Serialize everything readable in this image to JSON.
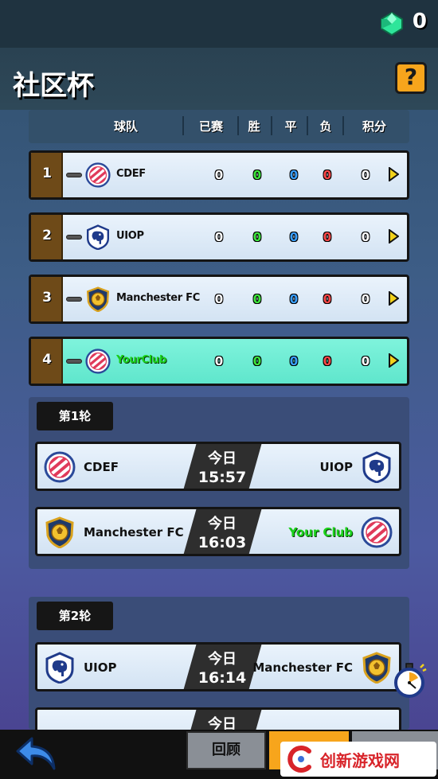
{
  "currency": {
    "icon": "gem-icon",
    "count": "0"
  },
  "page": {
    "title": "社区杯",
    "help": "?"
  },
  "table": {
    "headers": {
      "team": "球队",
      "played": "已赛",
      "won": "胜",
      "drawn": "平",
      "lost": "负",
      "points": "积分"
    },
    "rows": [
      {
        "rank": "1",
        "team": "CDEF",
        "crest": "striped-ball-crest-icon",
        "played": "0",
        "won": "0",
        "drawn": "0",
        "lost": "0",
        "points": "0"
      },
      {
        "rank": "2",
        "team": "UIOP",
        "crest": "elephant-shield-crest-icon",
        "played": "0",
        "won": "0",
        "drawn": "0",
        "lost": "0",
        "points": "0"
      },
      {
        "rank": "3",
        "team": "Manchester FC",
        "crest": "gold-ball-shield-crest-icon",
        "played": "0",
        "won": "0",
        "drawn": "0",
        "lost": "0",
        "points": "0"
      },
      {
        "rank": "4",
        "team": "YourClub",
        "crest": "striped-ball-crest-icon",
        "played": "0",
        "won": "0",
        "drawn": "0",
        "lost": "0",
        "points": "0"
      }
    ]
  },
  "rounds": [
    {
      "label": "第1轮",
      "matches": [
        {
          "home": "CDEF",
          "away": "UIOP",
          "day": "今日",
          "time": "15:57"
        },
        {
          "home": "Manchester FC",
          "away": "Your Club",
          "day": "今日",
          "time": "16:03"
        }
      ]
    },
    {
      "label": "第2轮",
      "matches": [
        {
          "home": "UIOP",
          "away": "Manchester FC",
          "day": "今日",
          "time": "16:14"
        },
        {
          "home": "",
          "away": "",
          "day": "今日",
          "time": ""
        }
      ]
    }
  ],
  "bottom": {
    "review": "回顾"
  },
  "watermark": {
    "text": "创新游戏网"
  },
  "colors": {
    "accent": "#f7a51c",
    "win": "#3ee83e",
    "draw": "#3aa0ff",
    "loss": "#ff4a4a",
    "mine": "#1bd21b"
  }
}
